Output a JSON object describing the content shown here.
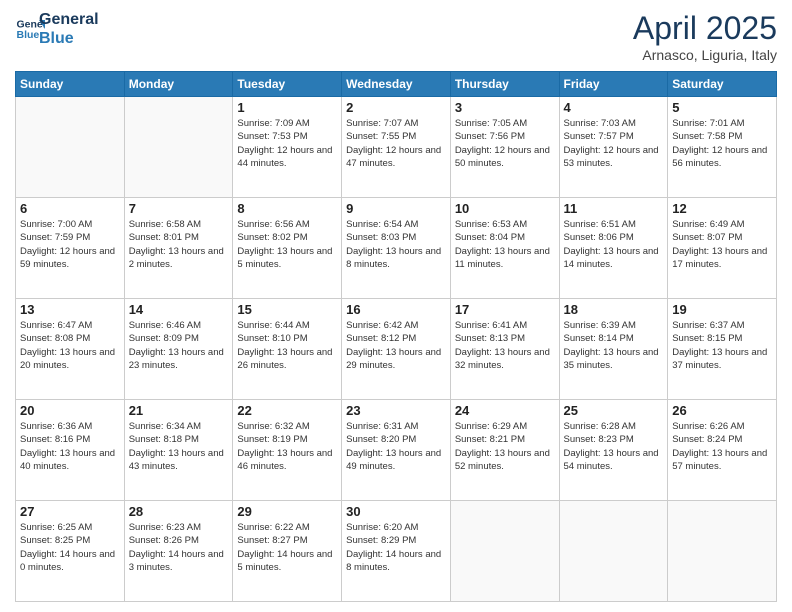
{
  "logo": {
    "line1": "General",
    "line2": "Blue"
  },
  "title": "April 2025",
  "subtitle": "Arnasco, Liguria, Italy",
  "days": [
    "Sunday",
    "Monday",
    "Tuesday",
    "Wednesday",
    "Thursday",
    "Friday",
    "Saturday"
  ],
  "weeks": [
    [
      {
        "day": "",
        "info": ""
      },
      {
        "day": "",
        "info": ""
      },
      {
        "day": "1",
        "info": "Sunrise: 7:09 AM\nSunset: 7:53 PM\nDaylight: 12 hours and 44 minutes."
      },
      {
        "day": "2",
        "info": "Sunrise: 7:07 AM\nSunset: 7:55 PM\nDaylight: 12 hours and 47 minutes."
      },
      {
        "day": "3",
        "info": "Sunrise: 7:05 AM\nSunset: 7:56 PM\nDaylight: 12 hours and 50 minutes."
      },
      {
        "day": "4",
        "info": "Sunrise: 7:03 AM\nSunset: 7:57 PM\nDaylight: 12 hours and 53 minutes."
      },
      {
        "day": "5",
        "info": "Sunrise: 7:01 AM\nSunset: 7:58 PM\nDaylight: 12 hours and 56 minutes."
      }
    ],
    [
      {
        "day": "6",
        "info": "Sunrise: 7:00 AM\nSunset: 7:59 PM\nDaylight: 12 hours and 59 minutes."
      },
      {
        "day": "7",
        "info": "Sunrise: 6:58 AM\nSunset: 8:01 PM\nDaylight: 13 hours and 2 minutes."
      },
      {
        "day": "8",
        "info": "Sunrise: 6:56 AM\nSunset: 8:02 PM\nDaylight: 13 hours and 5 minutes."
      },
      {
        "day": "9",
        "info": "Sunrise: 6:54 AM\nSunset: 8:03 PM\nDaylight: 13 hours and 8 minutes."
      },
      {
        "day": "10",
        "info": "Sunrise: 6:53 AM\nSunset: 8:04 PM\nDaylight: 13 hours and 11 minutes."
      },
      {
        "day": "11",
        "info": "Sunrise: 6:51 AM\nSunset: 8:06 PM\nDaylight: 13 hours and 14 minutes."
      },
      {
        "day": "12",
        "info": "Sunrise: 6:49 AM\nSunset: 8:07 PM\nDaylight: 13 hours and 17 minutes."
      }
    ],
    [
      {
        "day": "13",
        "info": "Sunrise: 6:47 AM\nSunset: 8:08 PM\nDaylight: 13 hours and 20 minutes."
      },
      {
        "day": "14",
        "info": "Sunrise: 6:46 AM\nSunset: 8:09 PM\nDaylight: 13 hours and 23 minutes."
      },
      {
        "day": "15",
        "info": "Sunrise: 6:44 AM\nSunset: 8:10 PM\nDaylight: 13 hours and 26 minutes."
      },
      {
        "day": "16",
        "info": "Sunrise: 6:42 AM\nSunset: 8:12 PM\nDaylight: 13 hours and 29 minutes."
      },
      {
        "day": "17",
        "info": "Sunrise: 6:41 AM\nSunset: 8:13 PM\nDaylight: 13 hours and 32 minutes."
      },
      {
        "day": "18",
        "info": "Sunrise: 6:39 AM\nSunset: 8:14 PM\nDaylight: 13 hours and 35 minutes."
      },
      {
        "day": "19",
        "info": "Sunrise: 6:37 AM\nSunset: 8:15 PM\nDaylight: 13 hours and 37 minutes."
      }
    ],
    [
      {
        "day": "20",
        "info": "Sunrise: 6:36 AM\nSunset: 8:16 PM\nDaylight: 13 hours and 40 minutes."
      },
      {
        "day": "21",
        "info": "Sunrise: 6:34 AM\nSunset: 8:18 PM\nDaylight: 13 hours and 43 minutes."
      },
      {
        "day": "22",
        "info": "Sunrise: 6:32 AM\nSunset: 8:19 PM\nDaylight: 13 hours and 46 minutes."
      },
      {
        "day": "23",
        "info": "Sunrise: 6:31 AM\nSunset: 8:20 PM\nDaylight: 13 hours and 49 minutes."
      },
      {
        "day": "24",
        "info": "Sunrise: 6:29 AM\nSunset: 8:21 PM\nDaylight: 13 hours and 52 minutes."
      },
      {
        "day": "25",
        "info": "Sunrise: 6:28 AM\nSunset: 8:23 PM\nDaylight: 13 hours and 54 minutes."
      },
      {
        "day": "26",
        "info": "Sunrise: 6:26 AM\nSunset: 8:24 PM\nDaylight: 13 hours and 57 minutes."
      }
    ],
    [
      {
        "day": "27",
        "info": "Sunrise: 6:25 AM\nSunset: 8:25 PM\nDaylight: 14 hours and 0 minutes."
      },
      {
        "day": "28",
        "info": "Sunrise: 6:23 AM\nSunset: 8:26 PM\nDaylight: 14 hours and 3 minutes."
      },
      {
        "day": "29",
        "info": "Sunrise: 6:22 AM\nSunset: 8:27 PM\nDaylight: 14 hours and 5 minutes."
      },
      {
        "day": "30",
        "info": "Sunrise: 6:20 AM\nSunset: 8:29 PM\nDaylight: 14 hours and 8 minutes."
      },
      {
        "day": "",
        "info": ""
      },
      {
        "day": "",
        "info": ""
      },
      {
        "day": "",
        "info": ""
      }
    ]
  ]
}
